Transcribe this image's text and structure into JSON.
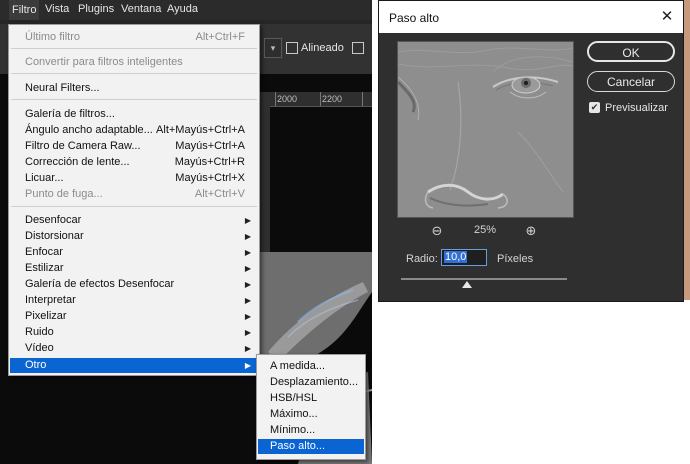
{
  "menubar": {
    "items": [
      "Filtro",
      "Vista",
      "Plugins",
      "Ventana",
      "Ayuda"
    ]
  },
  "options_bar": {
    "aligned_label": "Alineado"
  },
  "ruler": {
    "ticks": [
      "2000",
      "2200"
    ]
  },
  "filter_menu": {
    "items": [
      {
        "label": "Último filtro",
        "shortcut": "Alt+Ctrl+F",
        "disabled": true
      },
      {
        "label": "Convertir para filtros inteligentes",
        "disabled": true
      },
      {
        "label": "Neural Filters..."
      },
      {
        "label": "Galería de filtros..."
      },
      {
        "label": "Ángulo ancho adaptable...",
        "shortcut": "Alt+Mayús+Ctrl+A"
      },
      {
        "label": "Filtro de Camera Raw...",
        "shortcut": "Mayús+Ctrl+A"
      },
      {
        "label": "Corrección de lente...",
        "shortcut": "Mayús+Ctrl+R"
      },
      {
        "label": "Licuar...",
        "shortcut": "Mayús+Ctrl+X"
      },
      {
        "label": "Punto de fuga...",
        "shortcut": "Alt+Ctrl+V",
        "disabled": true
      },
      {
        "label": "Desenfocar"
      },
      {
        "label": "Distorsionar"
      },
      {
        "label": "Enfocar"
      },
      {
        "label": "Estilizar"
      },
      {
        "label": "Galería de efectos Desenfocar"
      },
      {
        "label": "Interpretar"
      },
      {
        "label": "Pixelizar"
      },
      {
        "label": "Ruido"
      },
      {
        "label": "Vídeo"
      },
      {
        "label": "Otro",
        "highlighted": true
      }
    ]
  },
  "other_submenu": {
    "items": [
      "A medida...",
      "Desplazamiento...",
      "HSB/HSL",
      "Máximo...",
      "Mínimo...",
      "Paso alto..."
    ],
    "highlighted": "Paso alto..."
  },
  "dialog": {
    "title": "Paso alto",
    "ok_label": "OK",
    "cancel_label": "Cancelar",
    "preview_label": "Previsualizar",
    "zoom": "25%",
    "radius_label": "Radio:",
    "radius_value": "10,0",
    "unit_label": "Píxeles"
  },
  "colors": {
    "highlight": "#0a64d2",
    "menu_bg": "#f2f2f2",
    "dialog_bg": "#2f2f2f"
  }
}
